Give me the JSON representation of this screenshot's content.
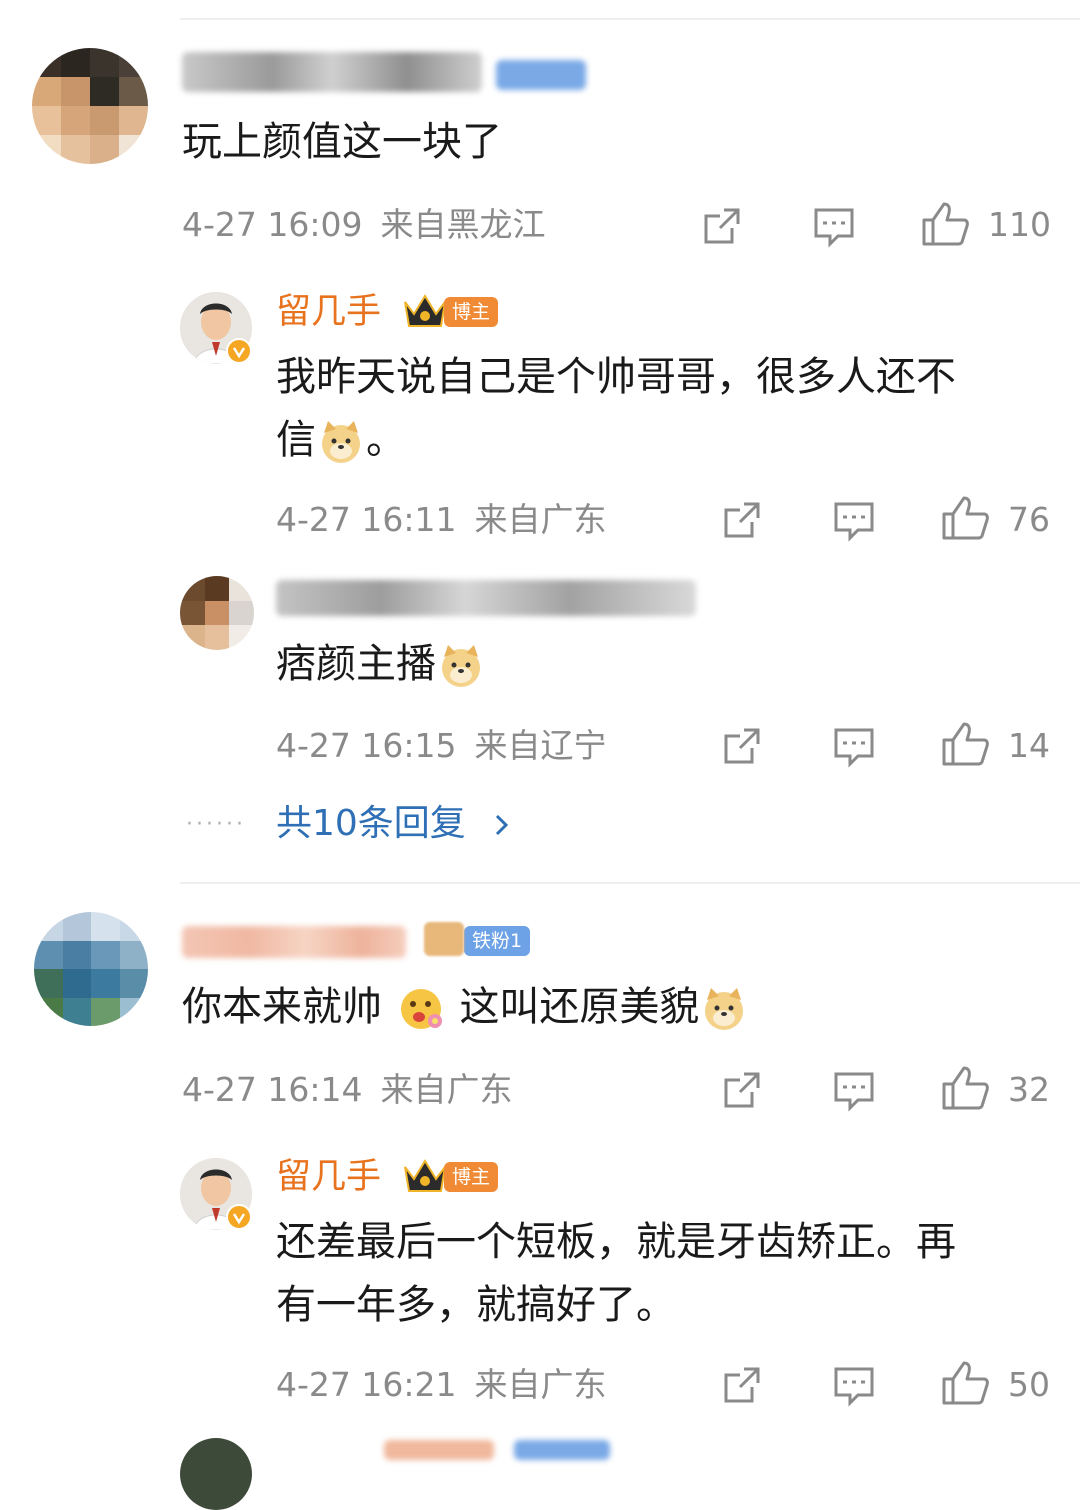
{
  "colors": {
    "username": "#e8731f",
    "link": "#2f6fb5",
    "meta": "#8a8a8a",
    "badge_blogger": "#f08a35",
    "badge_fan": "#6da2e6"
  },
  "comments": [
    {
      "text": "玩上颜值这一块了",
      "time": "4-27 16:09",
      "location": "来自黑龙江",
      "likes": "110",
      "replies": [
        {
          "username": "留几手",
          "badge": "博主",
          "text_line1": "我昨天说自己是个帅哥哥，很多人还不",
          "text_line2": "信",
          "text_line2_end": "。",
          "time": "4-27 16:11",
          "location": "来自广东",
          "likes": "76",
          "emoji": "doge-emoji"
        },
        {
          "text": "痞颜主播",
          "time": "4-27 16:15",
          "location": "来自辽宁",
          "likes": "14",
          "emoji": "doge-emoji"
        }
      ],
      "more_replies": "共10条回复"
    },
    {
      "badge": "铁粉1",
      "text_a": "你本来就帅",
      "text_b": "这叫还原美貌",
      "time": "4-27 16:14",
      "location": "来自广东",
      "likes": "32",
      "replies": [
        {
          "username": "留几手",
          "badge": "博主",
          "text_line1": "还差最后一个短板，就是牙齿矫正。再",
          "text_line2": "有一年多，就搞好了。",
          "time": "4-27 16:21",
          "location": "来自广东",
          "likes": "50"
        }
      ]
    }
  ],
  "icons": {
    "share": "share-icon",
    "comment": "comment-icon",
    "like": "thumbs-up-icon",
    "crown": "crown-icon",
    "chevron": "chevron-right-icon"
  }
}
